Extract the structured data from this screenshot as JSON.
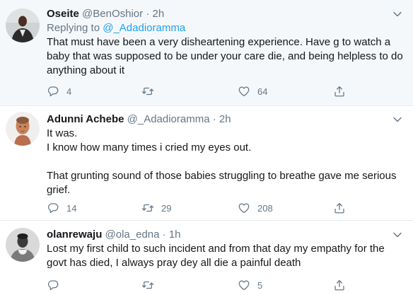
{
  "tweets": [
    {
      "name": "Oseite",
      "handle": "@BenOshior",
      "sep": "·",
      "time": "2h",
      "replying_prefix": "Replying to",
      "replying_handle": "@_Adadioramma",
      "lines": [
        "That must have been a very disheartening experience. Have g to watch a",
        "baby that was supposed to be under your care die, and being helpless to do",
        "anything about it"
      ],
      "reply_count": "4",
      "retweet_count": "",
      "like_count": "64"
    },
    {
      "name": "Adunni Achebe",
      "handle": "@_Adadioramma",
      "sep": "·",
      "time": "2h",
      "lines": [
        "It was.",
        "I know how many times i cried my eyes out.",
        "",
        "That grunting sound of those babies struggling to breathe gave me serious",
        "grief."
      ],
      "reply_count": "14",
      "retweet_count": "29",
      "like_count": "208"
    },
    {
      "name": "olanrewaju",
      "handle": "@ola_edna",
      "sep": "·",
      "time": "1h",
      "lines": [
        "Lost my first child to such incident and from that day my empathy for the",
        "govt has died, I always pray dey all die a painful death"
      ],
      "reply_count": "",
      "retweet_count": "",
      "like_count": "5"
    }
  ],
  "icons": {
    "reply": "reply-icon",
    "retweet": "retweet-icon",
    "like": "heart-icon",
    "share": "share-icon",
    "more": "chevron-down-icon"
  },
  "colors": {
    "link": "#1da1f2",
    "secondary_text": "#657786",
    "highlight_bg": "#f5f8fa",
    "divider": "#e6ecf0"
  }
}
